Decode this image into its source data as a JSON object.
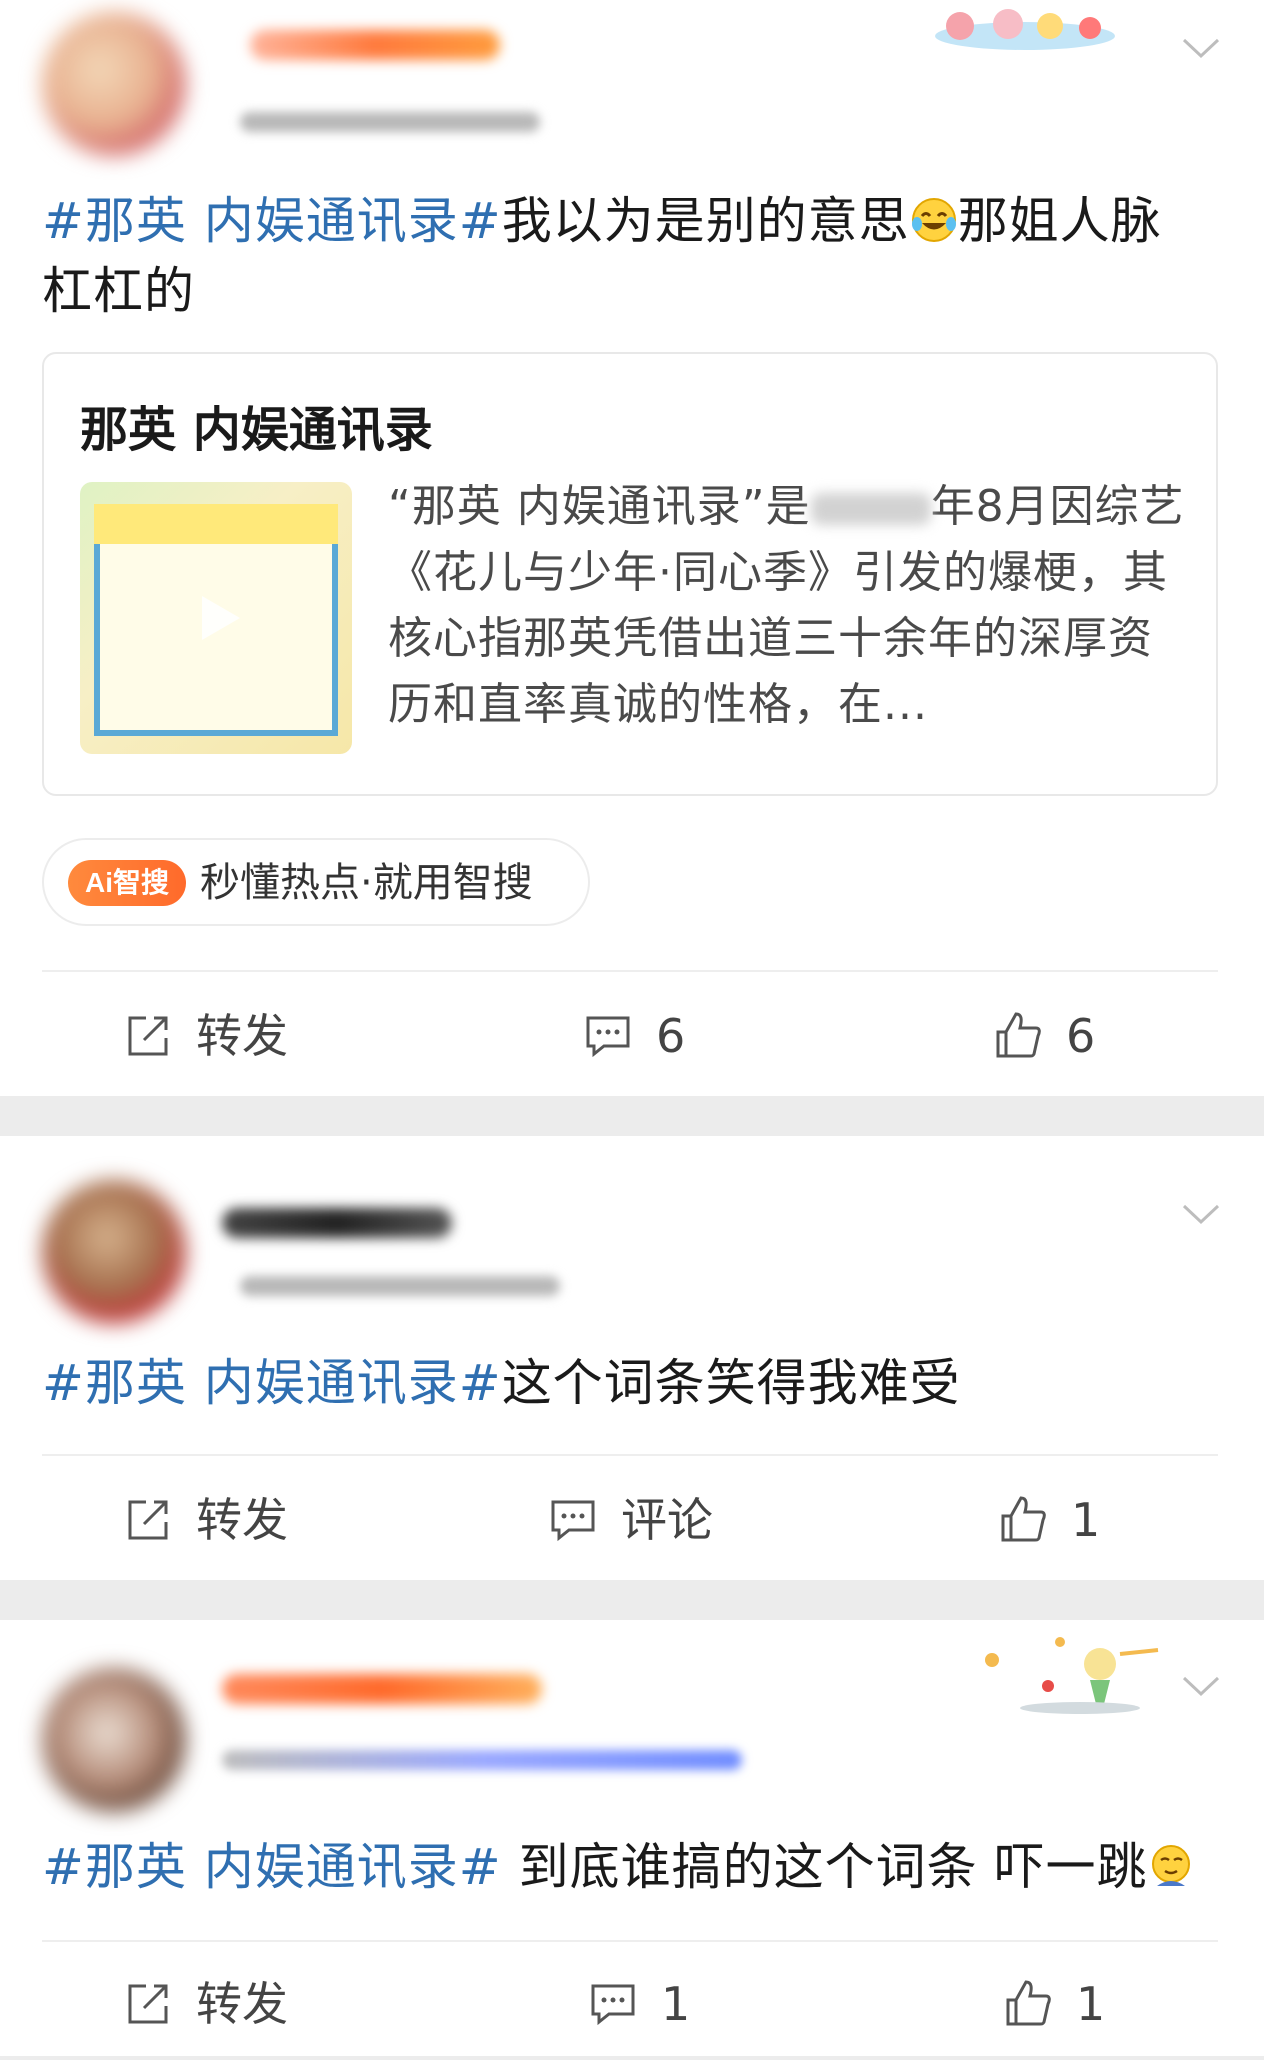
{
  "posts": [
    {
      "hashtag": "#那英 内娱通讯录#",
      "text_before_emoji": "我以为是别的意思",
      "emoji": "crying-laughing-emoji",
      "text_after_emoji": "那姐人脉杠杠的",
      "card": {
        "title": "那英 内娱通讯录",
        "desc_part1": "“那英 内娱通讯录”是",
        "desc_part2": "年8月因综艺《花儿与少年·同心季》引发的爆梗，其核心指那英凭借出道三十余年的深厚资历和直率真诚的性格，在..."
      },
      "ai_chip": {
        "badge": "Ai智搜",
        "text": "秒懂热点·就用智搜"
      },
      "actions": {
        "repost": "转发",
        "comment": "6",
        "like": "6"
      }
    },
    {
      "hashtag": "#那英 内娱通讯录#",
      "text": "这个词条笑得我难受",
      "actions": {
        "repost": "转发",
        "comment": "评论",
        "like": "1"
      }
    },
    {
      "hashtag": "#那英 内娱通讯录#",
      "text": " 到底谁搞的这个词条 吓一跳",
      "emoji": "thinking-emoji",
      "actions": {
        "repost": "转发",
        "comment": "1",
        "like": "1"
      }
    }
  ],
  "colors": {
    "hashtag": "#2f6fb1",
    "text": "#1a1a1a",
    "ai_badge": "#ff7a33",
    "page_bg": "#ececec"
  }
}
